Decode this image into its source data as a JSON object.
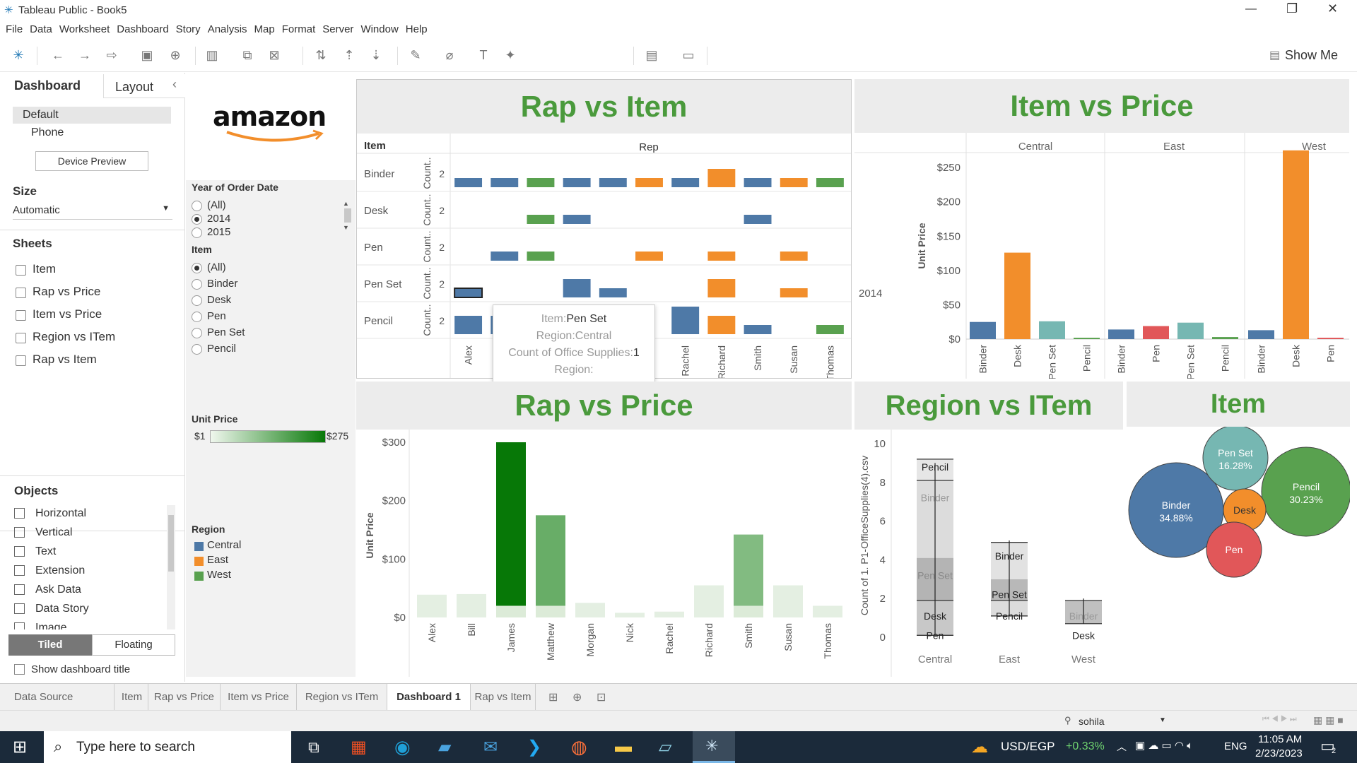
{
  "window": {
    "title": "Tableau Public - Book5",
    "minimize": "—",
    "maximize": "❐",
    "close": "✕"
  },
  "menu": [
    "File",
    "Data",
    "Worksheet",
    "Dashboard",
    "Story",
    "Analysis",
    "Map",
    "Format",
    "Server",
    "Window",
    "Help"
  ],
  "toolbar": {
    "show_me": "Show Me"
  },
  "left_panel": {
    "tab_dashboard": "Dashboard",
    "tab_layout": "Layout",
    "collapse": "‹",
    "device_default": "Default",
    "device_phone": "Phone",
    "device_preview": "Device Preview",
    "size_title": "Size",
    "size_value": "Automatic",
    "sheets_title": "Sheets",
    "sheets": [
      "Item",
      "Rap vs Price",
      "Item vs Price",
      "Region vs ITem",
      "Rap vs Item"
    ],
    "objects_title": "Objects",
    "objects": [
      "Horizontal",
      "Vertical",
      "Text",
      "Extension",
      "Ask Data",
      "Data Story",
      "Image"
    ],
    "tiled": "Tiled",
    "floating": "Floating",
    "show_title": "Show dashboard title"
  },
  "logo": {
    "text": "amazon"
  },
  "filters": {
    "year_title": "Year of Order Date",
    "year_options": [
      "(All)",
      "2014",
      "2015"
    ],
    "year_selected": "2014",
    "item_title": "Item",
    "item_options": [
      "(All)",
      "Binder",
      "Desk",
      "Pen",
      "Pen Set",
      "Pencil"
    ],
    "item_selected": "(All)",
    "price_title": "Unit Price",
    "price_min": "$1",
    "price_max": "$275",
    "region_title": "Region",
    "regions": [
      {
        "name": "Central",
        "color": "#4e79a7"
      },
      {
        "name": "East",
        "color": "#f28e2b"
      },
      {
        "name": "West",
        "color": "#59a14f"
      }
    ]
  },
  "rap_vs_item": {
    "title": "Rap vs Item",
    "row_header": "Item",
    "col_header": "Rep",
    "axis_label": "Count..",
    "axis_tick": "2",
    "items": [
      "Binder",
      "Desk",
      "Pen",
      "Pen Set",
      "Pencil"
    ],
    "reps": [
      "Alex",
      "Bill",
      "James",
      "Matthew",
      "Morgan",
      "Nick",
      "Rachel",
      "Richard",
      "Smith",
      "Susan",
      "Thomas"
    ],
    "tooltip": {
      "item_label": "Item:",
      "item_value": "Pen Set",
      "region_label": "Region:",
      "region_value": "Central",
      "count_label": "Count of Office Supplies:",
      "count_value": "1",
      "region2_label": "Region:",
      "region2_value": ""
    }
  },
  "item_vs_price": {
    "title": "Item vs Price",
    "year_label": "2014",
    "y_title": "Unit Price",
    "y_ticks": [
      "$250",
      "$200",
      "$150",
      "$100",
      "$50",
      "$0"
    ],
    "regions": [
      "Central",
      "East",
      "West"
    ]
  },
  "rap_vs_price": {
    "title": "Rap vs Price",
    "y_title": "Unit Price",
    "y_ticks": [
      "$300",
      "$200",
      "$100",
      "$0"
    ]
  },
  "region_vs_item": {
    "title": "Region vs ITem",
    "y_title": "Count of 1. P1-OfficeSupplies(4).csv",
    "y_ticks": [
      "10",
      "8",
      "6",
      "4",
      "2",
      "0"
    ],
    "regions": [
      "Central",
      "East",
      "West"
    ],
    "labels": {
      "central": [
        "Pencil",
        "Binder",
        "Pen Set",
        "Desk",
        "Pen"
      ],
      "east": [
        "Binder",
        "Pen Set",
        "Pencil"
      ],
      "west": [
        "Binder",
        "Desk"
      ]
    }
  },
  "item_bubbles": {
    "title": "Item",
    "bubbles": [
      {
        "name": "Binder",
        "pct": "34.88%",
        "color": "#4e79a7"
      },
      {
        "name": "Pen Set",
        "pct": "16.28%",
        "color": "#76b7b2"
      },
      {
        "name": "Pencil",
        "pct": "30.23%",
        "color": "#59a14f"
      },
      {
        "name": "Desk",
        "pct": "",
        "color": "#f28e2b"
      },
      {
        "name": "Pen",
        "pct": "",
        "color": "#e15759"
      }
    ]
  },
  "chart_data": [
    {
      "type": "bar",
      "title": "Rap vs Item",
      "xlabel": "Rep",
      "ylabel": "Count..",
      "categories": [
        "Alex",
        "Bill",
        "James",
        "Matthew",
        "Morgan",
        "Nick",
        "Rachel",
        "Richard",
        "Smith",
        "Susan",
        "Thomas"
      ],
      "series": [
        {
          "name": "Binder",
          "values": [
            1,
            1,
            1,
            1,
            1,
            1,
            1,
            2,
            1,
            1,
            1
          ],
          "regions": [
            "Central",
            "Central",
            "West",
            "Central",
            "Central",
            "East",
            "Central",
            "East",
            "Central",
            "East",
            "West"
          ]
        },
        {
          "name": "Desk",
          "values": [
            0,
            0,
            1,
            1,
            0,
            0,
            0,
            0,
            1,
            0,
            0
          ],
          "regions": [
            "",
            "",
            "West",
            "Central",
            "",
            "",
            "",
            "",
            "Central",
            "",
            ""
          ]
        },
        {
          "name": "Pen",
          "values": [
            0,
            1,
            1,
            0,
            0,
            1,
            0,
            1,
            0,
            1,
            0
          ],
          "regions": [
            "",
            "Central",
            "West",
            "",
            "",
            "East",
            "",
            "East",
            "",
            "East",
            ""
          ]
        },
        {
          "name": "Pen Set",
          "values": [
            1,
            0,
            0,
            2,
            1,
            0,
            0,
            2,
            0,
            1,
            0
          ],
          "regions": [
            "Central",
            "",
            "",
            "Central",
            "Central",
            "",
            "",
            "East",
            "",
            "East",
            ""
          ]
        },
        {
          "name": "Pencil",
          "values": [
            2,
            2,
            0,
            0,
            0,
            0,
            3,
            2,
            1,
            0,
            1
          ],
          "regions": [
            "Central",
            "Central",
            "",
            "",
            "",
            "",
            "Central",
            "East",
            "Central",
            "",
            "West"
          ]
        }
      ]
    },
    {
      "type": "bar",
      "title": "Item vs Price",
      "ylabel": "Unit Price",
      "ylim": [
        0,
        280
      ],
      "groups": [
        {
          "region": "Central",
          "categories": [
            "Binder",
            "Desk",
            "Pen Set",
            "Pencil"
          ],
          "values": [
            25,
            126,
            26,
            2
          ],
          "colors": [
            "#4e79a7",
            "#f28e2b",
            "#76b7b2",
            "#59a14f"
          ]
        },
        {
          "region": "East",
          "categories": [
            "Binder",
            "Pen",
            "Pen Set",
            "Pencil"
          ],
          "values": [
            14,
            19,
            24,
            3
          ],
          "colors": [
            "#4e79a7",
            "#e15759",
            "#76b7b2",
            "#59a14f"
          ]
        },
        {
          "region": "West",
          "categories": [
            "Binder",
            "Desk",
            "Pen"
          ],
          "values": [
            13,
            275,
            2
          ],
          "colors": [
            "#4e79a7",
            "#f28e2b",
            "#e15759"
          ]
        }
      ]
    },
    {
      "type": "bar",
      "title": "Rap vs Price",
      "ylabel": "Unit Price",
      "ylim": [
        0,
        300
      ],
      "categories": [
        "Alex",
        "Bill",
        "James",
        "Matthew",
        "Morgan",
        "Nick",
        "Rachel",
        "Richard",
        "Smith",
        "Susan",
        "Thomas"
      ],
      "values": [
        39,
        40,
        300,
        175,
        25,
        8,
        10,
        55,
        142,
        55,
        20
      ],
      "highlight": [
        false,
        false,
        true,
        true,
        false,
        false,
        false,
        false,
        true,
        false,
        false
      ]
    },
    {
      "type": "bar",
      "title": "Region vs ITem",
      "ylabel": "Count of 1. P1-OfficeSupplies(4).csv",
      "ylim": [
        0,
        10
      ],
      "categories": [
        "Central",
        "East",
        "West"
      ],
      "values": [
        9,
        5,
        2
      ]
    }
  ],
  "sheet_tabs": {
    "data_source": "Data Source",
    "tabs": [
      "Item",
      "Rap vs Price",
      "Item vs Price",
      "Region vs ITem",
      "Dashboard 1",
      "Rap vs Item"
    ],
    "active": "Dashboard 1"
  },
  "status": {
    "user": "sohila"
  },
  "taskbar": {
    "search": "Type here to search",
    "ticker": "USD/EGP",
    "change": "+0.33%",
    "lang": "ENG",
    "time": "11:05 AM",
    "date": "2/23/2023",
    "notif": "2"
  }
}
